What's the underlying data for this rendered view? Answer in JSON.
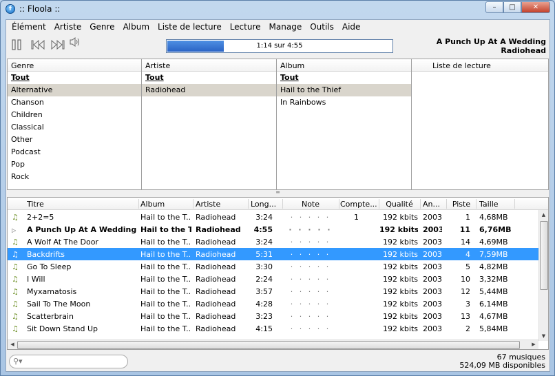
{
  "window": {
    "title": ":: Floola ::",
    "controls": [
      "–",
      "□",
      "✕"
    ]
  },
  "menu": [
    "Élément",
    "Artiste",
    "Genre",
    "Album",
    "Liste de lecture",
    "Lecture",
    "Manage",
    "Outils",
    "Aide"
  ],
  "player": {
    "progress_text": "1:14 sur 4:55",
    "progress_fraction": 0.25,
    "now_playing_title": "A Punch Up At A Wedding",
    "now_playing_artist": "Radiohead"
  },
  "browser": {
    "genre": {
      "header": "Genre",
      "items": [
        "Tout",
        "Alternative",
        "Chanson",
        "Children",
        "Classical",
        "Other",
        "Podcast",
        "Pop",
        "Rock"
      ],
      "selected": 1
    },
    "artist": {
      "header": "Artiste",
      "items": [
        "Tout",
        "Radiohead"
      ],
      "selected": 1
    },
    "album": {
      "header": "Album",
      "items": [
        "Tout",
        "Hail to the Thief",
        "In Rainbows"
      ],
      "selected": 1
    },
    "playlist": {
      "header": "Liste de lecture",
      "items": []
    }
  },
  "tracks": {
    "columns": [
      "Titre",
      "Album",
      "Artiste",
      "Long...",
      "Note",
      "Compte...",
      "Qualité",
      "An...",
      "Piste",
      "Taille"
    ],
    "rows": [
      {
        "title": "2+2=5",
        "album": "Hail to the T...",
        "artist": "Radiohead",
        "length": "3:24",
        "rating": "· · · · ·",
        "count": "1",
        "quality": "192 kbits",
        "year": "2003",
        "track": "1",
        "size": "4,68MB",
        "state": "normal"
      },
      {
        "title": "A Punch Up At A Wedding",
        "album": "Hail to the T...",
        "artist": "Radiohead",
        "length": "4:55",
        "rating": "· · · · ·",
        "count": "",
        "quality": "192 kbits",
        "year": "2003",
        "track": "11",
        "size": "6,76MB",
        "state": "playing"
      },
      {
        "title": "A Wolf At The Door",
        "album": "Hail to the T...",
        "artist": "Radiohead",
        "length": "3:24",
        "rating": "· · · · ·",
        "count": "",
        "quality": "192 kbits",
        "year": "2003",
        "track": "14",
        "size": "4,69MB",
        "state": "normal"
      },
      {
        "title": "Backdrifts",
        "album": "Hail to the T...",
        "artist": "Radiohead",
        "length": "5:31",
        "rating": "· · · · ·",
        "count": "",
        "quality": "192 kbits",
        "year": "2003",
        "track": "4",
        "size": "7,59MB",
        "state": "selected"
      },
      {
        "title": "Go To Sleep",
        "album": "Hail to the T...",
        "artist": "Radiohead",
        "length": "3:30",
        "rating": "· · · · ·",
        "count": "",
        "quality": "192 kbits",
        "year": "2003",
        "track": "5",
        "size": "4,82MB",
        "state": "normal"
      },
      {
        "title": "I Will",
        "album": "Hail to the T...",
        "artist": "Radiohead",
        "length": "2:24",
        "rating": "· · · · ·",
        "count": "",
        "quality": "192 kbits",
        "year": "2003",
        "track": "10",
        "size": "3,32MB",
        "state": "normal"
      },
      {
        "title": "Myxamatosis",
        "album": "Hail to the T...",
        "artist": "Radiohead",
        "length": "3:57",
        "rating": "· · · · ·",
        "count": "",
        "quality": "192 kbits",
        "year": "2003",
        "track": "12",
        "size": "5,44MB",
        "state": "normal"
      },
      {
        "title": "Sail To The Moon",
        "album": "Hail to the T...",
        "artist": "Radiohead",
        "length": "4:28",
        "rating": "· · · · ·",
        "count": "",
        "quality": "192 kbits",
        "year": "2003",
        "track": "3",
        "size": "6,14MB",
        "state": "normal"
      },
      {
        "title": "Scatterbrain",
        "album": "Hail to the T...",
        "artist": "Radiohead",
        "length": "3:23",
        "rating": "· · · · ·",
        "count": "",
        "quality": "192 kbits",
        "year": "2003",
        "track": "13",
        "size": "4,67MB",
        "state": "normal"
      },
      {
        "title": "Sit Down Stand Up",
        "album": "Hail to the T...",
        "artist": "Radiohead",
        "length": "4:15",
        "rating": "· · · · ·",
        "count": "",
        "quality": "192 kbits",
        "year": "2003",
        "track": "2",
        "size": "5,84MB",
        "state": "normal"
      }
    ]
  },
  "status": {
    "count": "67 musiques",
    "space": "524,09 MB disponibles"
  },
  "colors": {
    "selection": "#3399ff",
    "progress": "#2a63c5",
    "browser_selected": "#d9d5cc"
  }
}
